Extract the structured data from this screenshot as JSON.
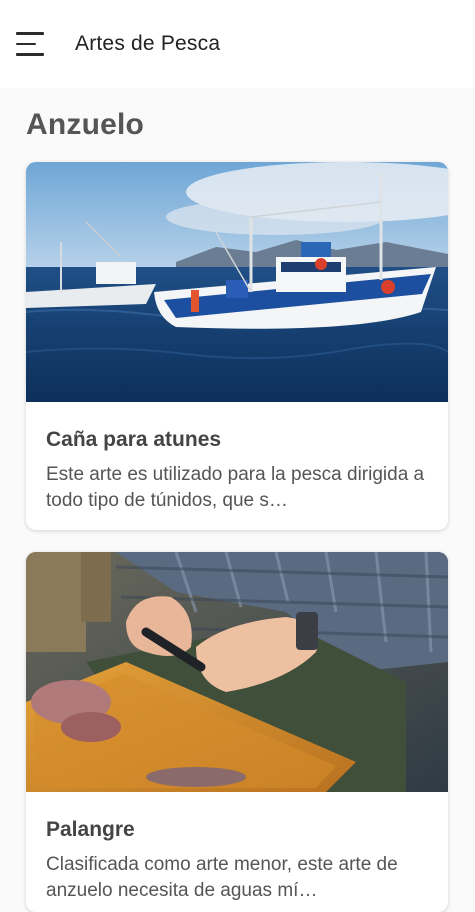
{
  "appbar": {
    "title": "Artes de Pesca",
    "menu_icon": "hamburger-menu-icon"
  },
  "section": {
    "title": "Anzuelo"
  },
  "cards": [
    {
      "title": "Caña para atunes",
      "description": "Este arte es utilizado para la pesca dirigida a todo tipo de túnidos, que s…"
    },
    {
      "title": "Palangre",
      "description": "Clasificada como arte menor, este arte de anzuelo necesita de aguas mí…"
    }
  ],
  "colors": {
    "background": "#fafafa",
    "appbar": "#ffffff",
    "card": "#ffffff"
  }
}
